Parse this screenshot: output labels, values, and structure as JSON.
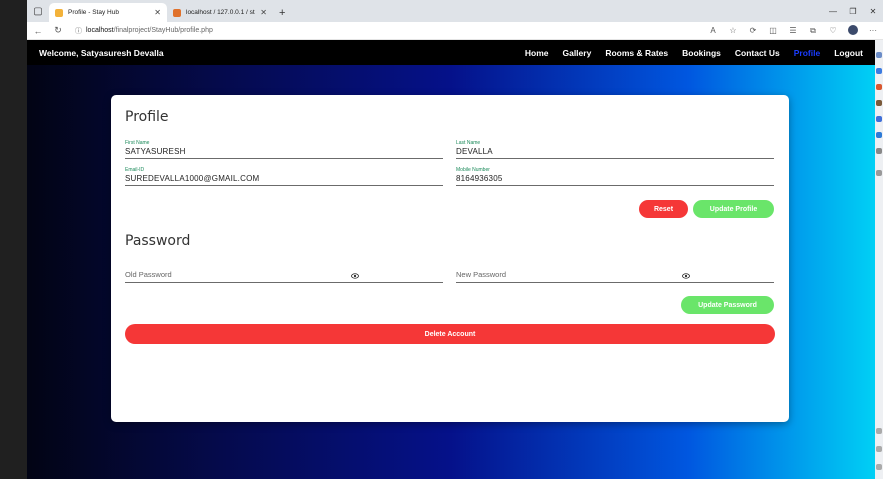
{
  "browser": {
    "tabs": [
      {
        "title": "Profile - Stay Hub",
        "active": true
      },
      {
        "title": "localhost / 127.0.0.1 / stayhub / ...",
        "active": false
      }
    ],
    "address": {
      "host": "localhost",
      "path": "/finalproject/StayHub/profile.php"
    }
  },
  "navbar": {
    "welcome": "Welcome, Satyasuresh Devalla",
    "links": [
      "Home",
      "Gallery",
      "Rooms & Rates",
      "Bookings",
      "Contact Us",
      "Profile",
      "Logout"
    ],
    "active_link": "Profile"
  },
  "profile": {
    "title": "Profile",
    "first_name": {
      "label": "First Name",
      "value": "SATYASURESH"
    },
    "last_name": {
      "label": "Last Name",
      "value": "DEVALLA"
    },
    "email": {
      "label": "Email-ID",
      "value": "SUREDEVALLA1000@GMAIL.COM"
    },
    "mobile": {
      "label": "Mobile Number",
      "value": "8164936305"
    },
    "reset_label": "Reset",
    "update_label": "Update Profile"
  },
  "password": {
    "title": "Password",
    "old_placeholder": "Old Password",
    "new_placeholder": "New Password",
    "update_label": "Update Password"
  },
  "delete_label": "Delete Account",
  "colors": {
    "danger": "#f53737",
    "success": "#6ae56a",
    "label_green": "#1b8a5a",
    "nav_active": "#1a3cff"
  }
}
